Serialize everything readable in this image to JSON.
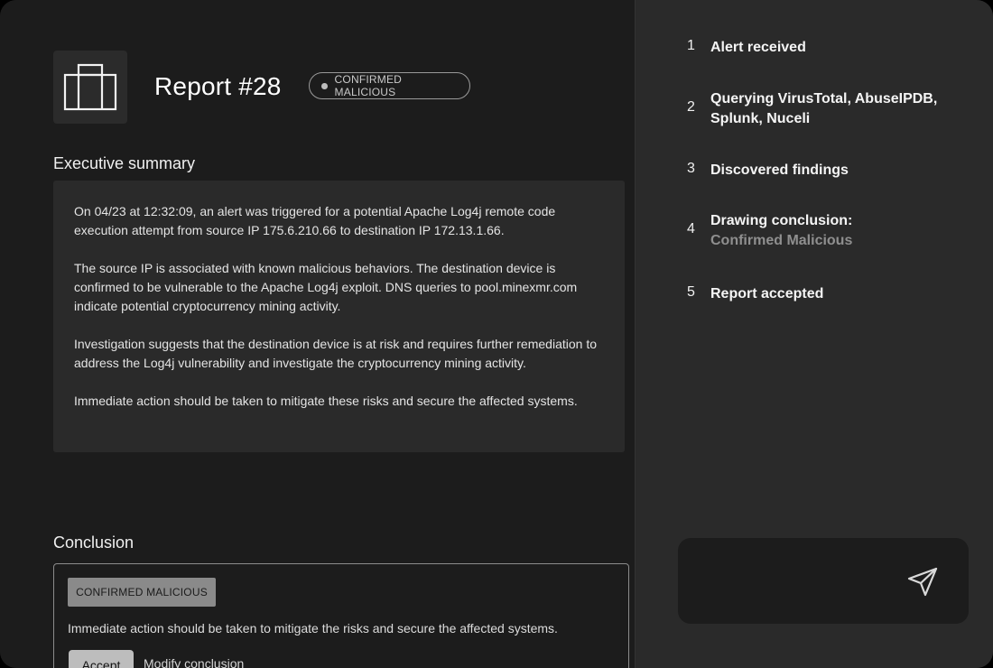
{
  "report": {
    "title": "Report #28",
    "status_badge": "CONFIRMED MALICIOUS"
  },
  "summary": {
    "heading": "Executive summary",
    "paragraphs": [
      "On 04/23 at 12:32:09, an alert was triggered for a potential Apache Log4j remote code execution attempt from source IP 175.6.210.66 to destination IP 172.13.1.66.",
      "The source IP is associated with known malicious behaviors. The destination device is confirmed to be vulnerable to the Apache Log4j exploit. DNS queries to pool.minexmr.com indicate potential cryptocurrency mining activity.",
      "Investigation suggests that the destination device is at risk and requires further remediation to address the Log4j vulnerability and investigate the cryptocurrency mining activity.",
      "Immediate action should be taken to mitigate these risks and secure the affected systems."
    ]
  },
  "conclusion": {
    "heading": "Conclusion",
    "tag": "CONFIRMED MALICIOUS",
    "text": "Immediate action should be taken to mitigate the risks and secure the affected systems.",
    "accept_label": "Accept",
    "modify_label": "Modify conclusion"
  },
  "steps": [
    {
      "num": "1",
      "label": "Alert received",
      "sub": ""
    },
    {
      "num": "2",
      "label": "Querying VirusTotal, AbuseIPDB, Splunk, Nuceli",
      "sub": ""
    },
    {
      "num": "3",
      "label": "Discovered findings",
      "sub": ""
    },
    {
      "num": "4",
      "label": "Drawing conclusion:",
      "sub": "Confirmed Malicious"
    },
    {
      "num": "5",
      "label": "Report accepted",
      "sub": ""
    }
  ],
  "chat": {
    "placeholder": "",
    "send_icon": "send-icon"
  },
  "colors": {
    "panel_left": "#1c1c1c",
    "panel_right": "#2a2a2a",
    "badge_tag": "#8a8a8a",
    "accept_button": "#bdbdbd"
  }
}
